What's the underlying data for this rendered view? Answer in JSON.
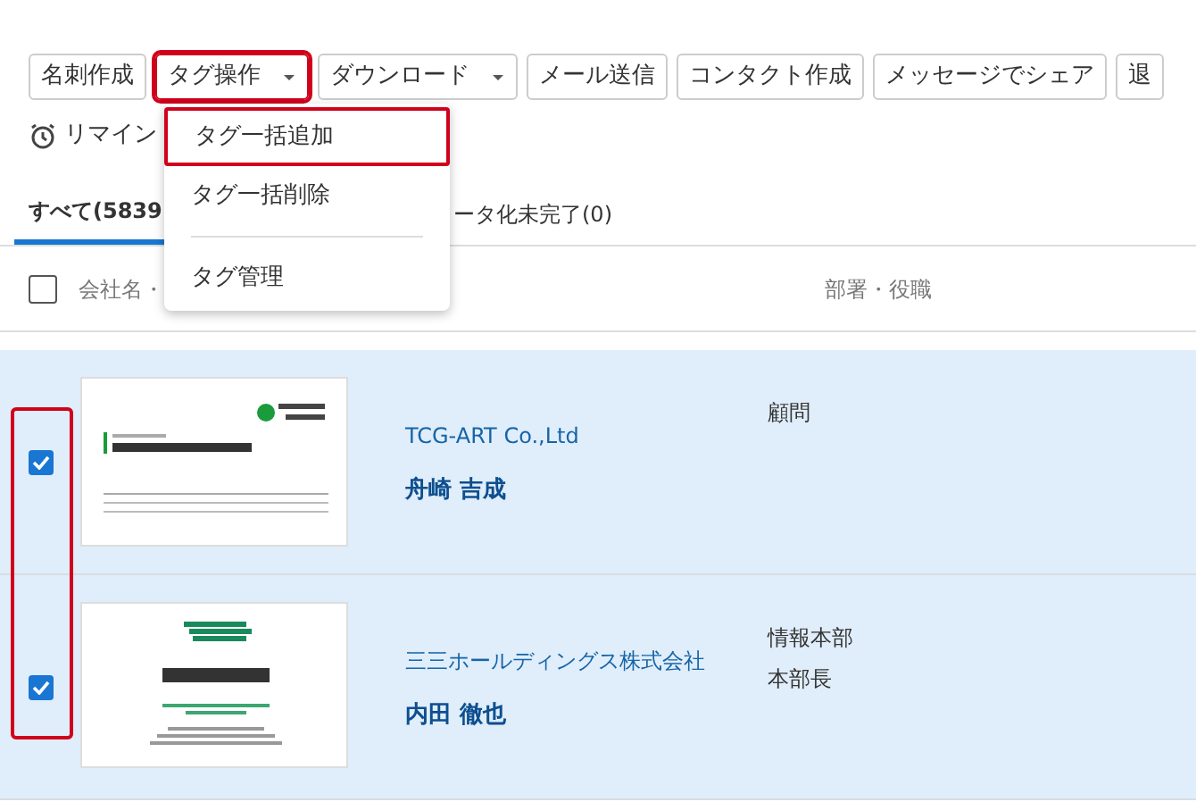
{
  "toolbar": {
    "buttons": [
      {
        "label": "名刺作成",
        "dropdown": false,
        "highlighted": false
      },
      {
        "label": "タグ操作",
        "dropdown": true,
        "highlighted": true
      },
      {
        "label": "ダウンロード",
        "dropdown": true,
        "highlighted": false
      },
      {
        "label": "メール送信",
        "dropdown": false,
        "highlighted": false
      },
      {
        "label": "コンタクト作成",
        "dropdown": false,
        "highlighted": false
      },
      {
        "label": "メッセージでシェア",
        "dropdown": false,
        "highlighted": false
      },
      {
        "label": "退",
        "dropdown": false,
        "highlighted": false
      }
    ]
  },
  "reminder": {
    "label": "リマイン"
  },
  "dropdown_menu": {
    "items": [
      {
        "kind": "item",
        "label": "タグ一括追加",
        "highlighted": true
      },
      {
        "kind": "item",
        "label": "タグ一括削除",
        "highlighted": false
      },
      {
        "kind": "divider"
      },
      {
        "kind": "item",
        "label": "タグ管理",
        "highlighted": false
      }
    ]
  },
  "tabs": [
    {
      "label": "すべて(5839",
      "selected": true
    },
    {
      "label": "ータ化未完了(0)",
      "selected": false
    }
  ],
  "table": {
    "header": {
      "checked": false,
      "columns": [
        "会社名・",
        "部署・役職"
      ]
    },
    "checkbox_highlight": true,
    "rows": [
      {
        "checked": true,
        "kind": "logo-card",
        "company": "TCG-ART Co.,Ltd",
        "name": "舟崎 吉成",
        "department": [
          "顧問"
        ]
      },
      {
        "checked": true,
        "kind": "bar-card",
        "company": "三三ホールディングス株式会社",
        "name": "内田 徹也",
        "department": [
          "情報本部",
          "本部長"
        ]
      }
    ]
  }
}
